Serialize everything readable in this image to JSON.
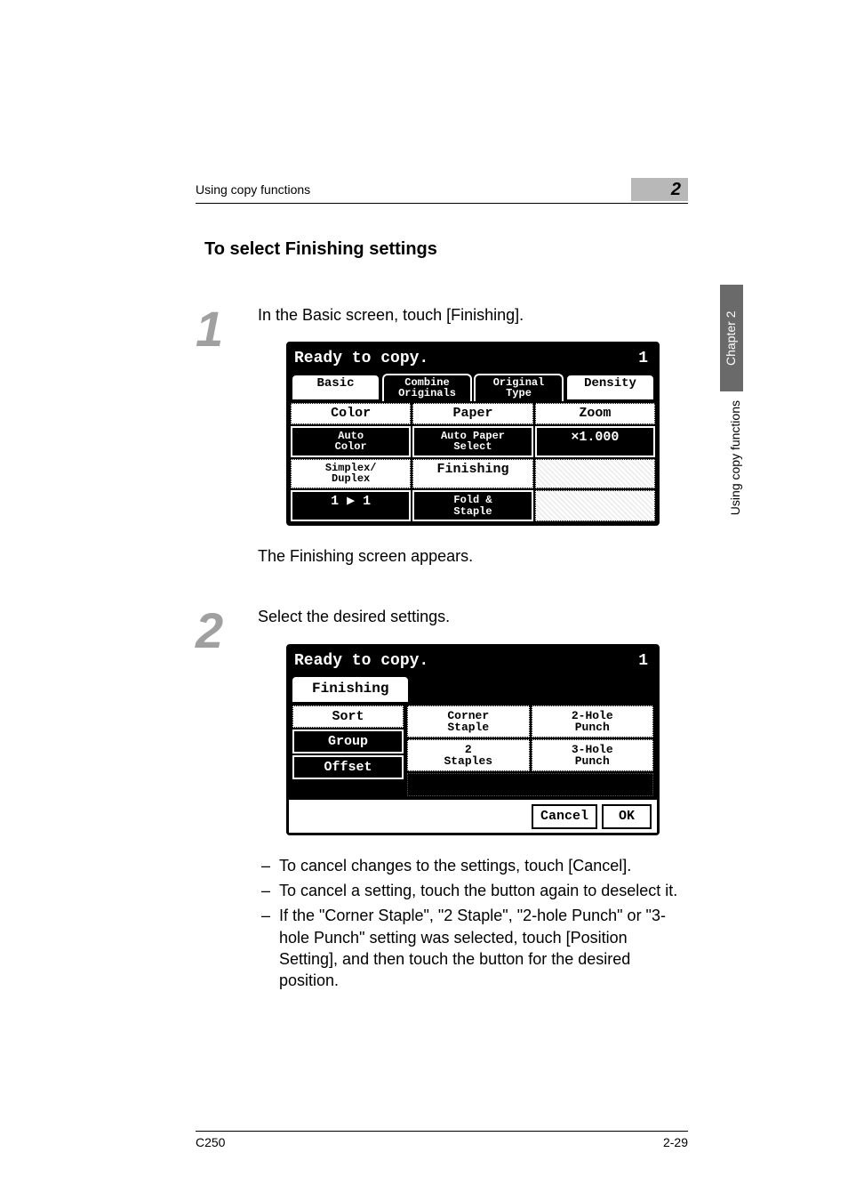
{
  "header": {
    "breadcrumb": "Using copy functions",
    "chapter_num": "2"
  },
  "title": "To select Finishing settings",
  "side": {
    "chapter_label": "Chapter 2",
    "section_label": "Using copy functions"
  },
  "step1": {
    "num": "1",
    "text": "In the Basic screen, touch [Finishing].",
    "after_text": "The Finishing screen appears.",
    "lcd": {
      "status": "Ready to copy.",
      "count": "1",
      "tabs": {
        "basic": "Basic",
        "combine": "Combine\nOriginals",
        "original": "Original\nType",
        "density": "Density"
      },
      "cells": {
        "color": "Color",
        "auto_color": "Auto\nColor",
        "paper": "Paper",
        "auto_paper": "Auto Paper\nSelect",
        "zoom": "Zoom",
        "zoom_val": "×1.000",
        "simplex": "Simplex/\nDuplex",
        "simplex_val": "1 ▶ 1",
        "finishing": "Finishing",
        "fold": "Fold &\nStaple"
      }
    }
  },
  "step2": {
    "num": "2",
    "text": "Select the desired settings.",
    "lcd": {
      "status": "Ready to copy.",
      "count": "1",
      "tab": "Finishing",
      "col1": {
        "sort": "Sort",
        "group": "Group",
        "offset": "Offset"
      },
      "col2": {
        "corner": "Corner\nStaple",
        "punch2": "2-Hole\nPunch",
        "staples2": "2\nStaples",
        "punch3": "3-Hole\nPunch"
      },
      "cancel": "Cancel",
      "ok": "OK"
    },
    "bullets": [
      "To cancel changes to the settings, touch [Cancel].",
      "To cancel a setting, touch the button again to deselect it.",
      "If the \"Corner Staple\", \"2 Staple\", \"2-hole Punch\" or \"3-hole Punch\" setting was selected, touch [Position Setting], and then touch the button for the desired position."
    ]
  },
  "footer": {
    "model": "C250",
    "page": "2-29"
  }
}
